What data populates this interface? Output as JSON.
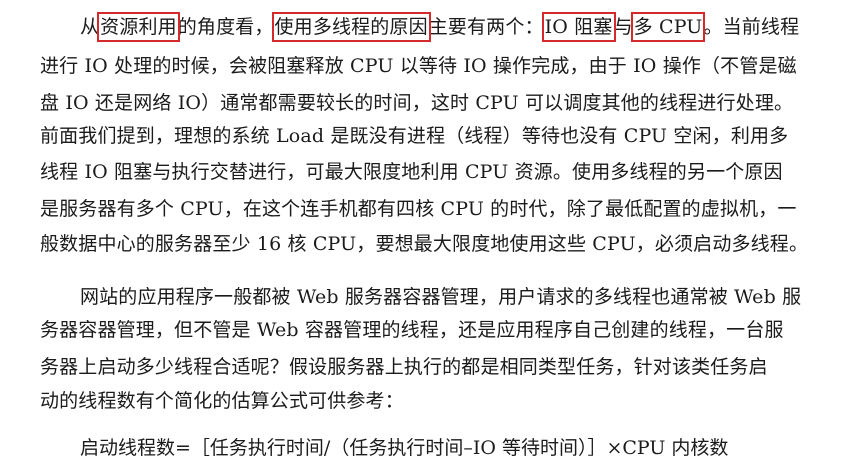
{
  "paragraph1": {
    "line1": {
      "prefix": "从",
      "hl1": "资源利用",
      "mid1": "的角度看，",
      "hl2": "使用多线程的原因",
      "mid2": "主要有两个：",
      "hl3": "IO 阻塞",
      "mid3": "与",
      "hl4": "多 CPU",
      "suffix": "。当前线程"
    },
    "line2": "进行 IO 处理的时候，会被阻塞释放 CPU 以等待 IO 操作完成，由于 IO 操作（不管是磁",
    "line3": "盘 IO 还是网络 IO）通常都需要较长的时间，这时 CPU 可以调度其他的线程进行处理。",
    "line4": "前面我们提到，理想的系统 Load 是既没有进程（线程）等待也没有 CPU 空闲，利用多",
    "line5": "线程 IO 阻塞与执行交替进行，可最大限度地利用 CPU 资源。使用多线程的另一个原因",
    "line6": "是服务器有多个 CPU，在这个连手机都有四核 CPU 的时代，除了最低配置的虚拟机，一",
    "line7": "般数据中心的服务器至少 16 核 CPU，要想最大限度地使用这些 CPU，必须启动多线程。"
  },
  "paragraph2": {
    "line1": "网站的应用程序一般都被 Web 服务器容器管理，用户请求的多线程也通常被 Web 服",
    "line2": "务器容器管理，但不管是 Web 容器管理的线程，还是应用程序自己创建的线程，一台服",
    "line3": "务器上启动多少线程合适呢？假设服务器上执行的都是相同类型任务，针对该类任务启",
    "line4": "动的线程数有个简化的估算公式可供参考："
  },
  "formula": "启动线程数=［任务执行时间/（任务执行时间–IO 等待时间）］×CPU 内核数",
  "colors": {
    "highlight_box": "#d52a2a",
    "text": "#1b1b1b",
    "background": "#ffffff"
  }
}
